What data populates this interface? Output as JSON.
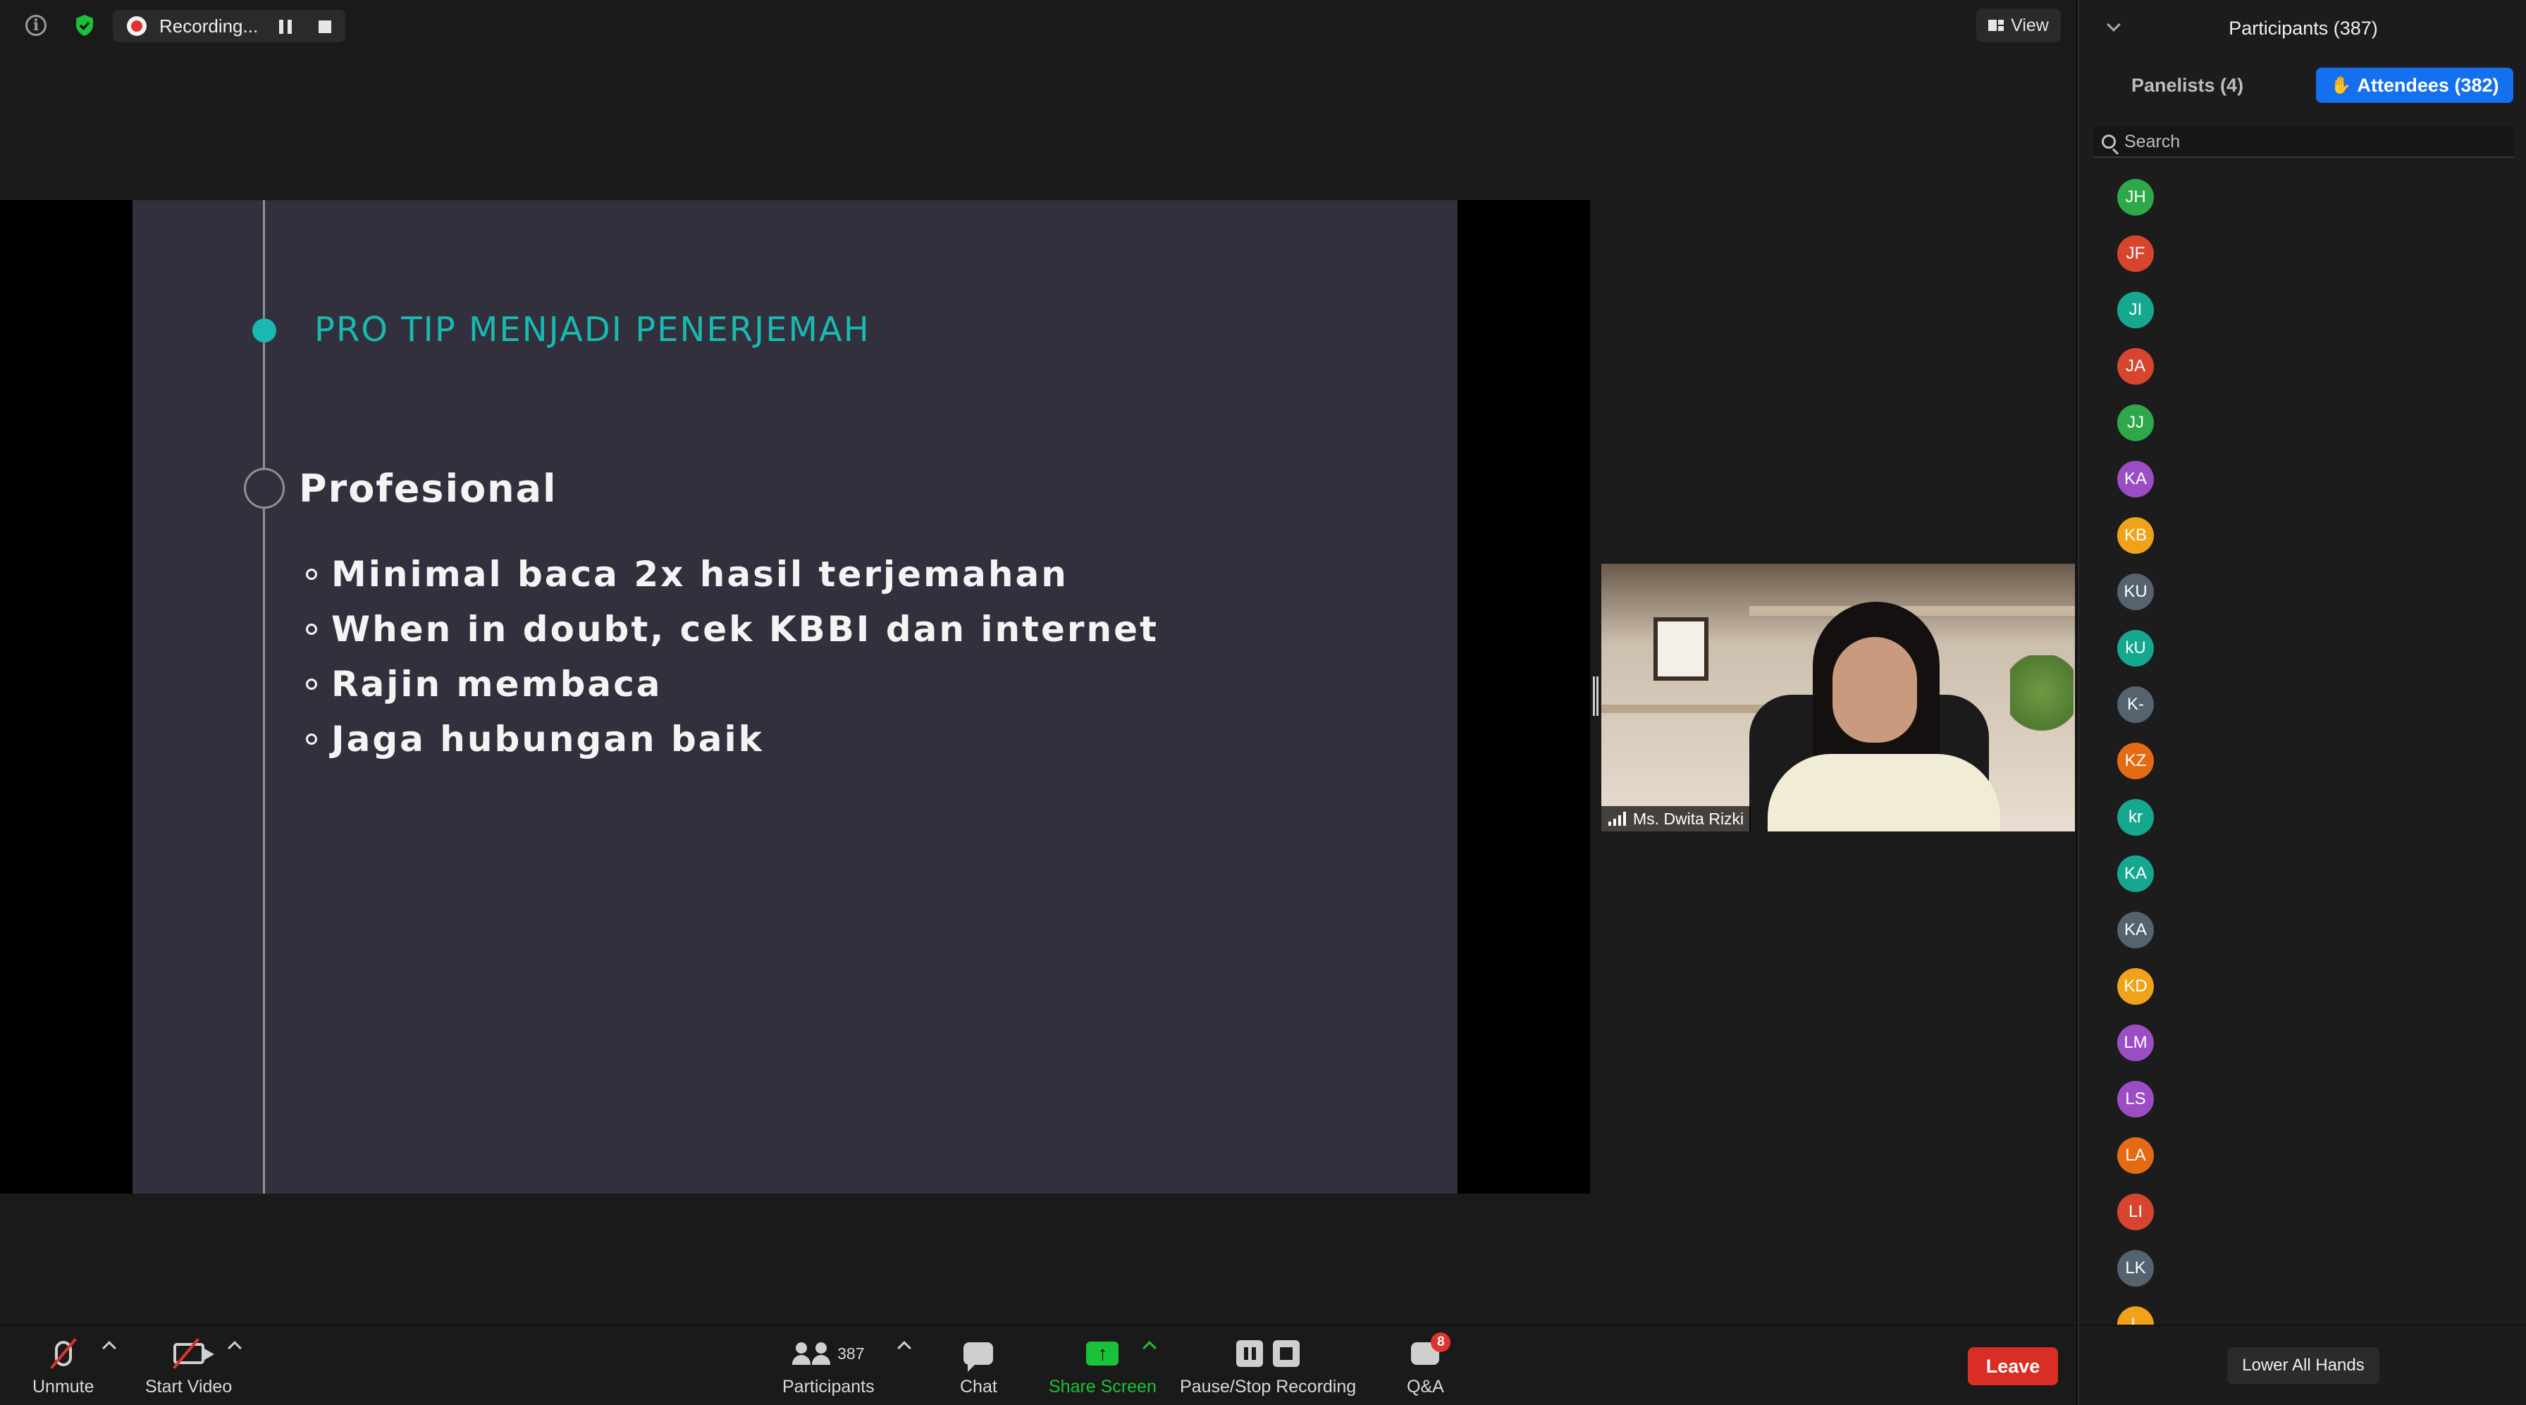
{
  "topbar": {
    "recording_label": "Recording...",
    "view_label": "View"
  },
  "slide": {
    "title": "PRO TIP MENJADI PENERJEMAH",
    "heading": "Profesional",
    "bullets": [
      "Minimal baca 2x hasil terjemahan",
      "When in doubt, cek KBBI dan internet",
      "Rajin membaca",
      "Jaga hubungan baik"
    ],
    "accent_color": "#19b8b0",
    "background_color": "#31303c"
  },
  "video": {
    "participant_name": "Ms. Dwita Rizki"
  },
  "toolbar": {
    "unmute_label": "Unmute",
    "start_video_label": "Start Video",
    "participants_label": "Participants",
    "participants_count": "387",
    "chat_label": "Chat",
    "share_screen_label": "Share Screen",
    "pause_stop_recording_label": "Pause/Stop Recording",
    "qa_label": "Q&A",
    "qa_badge": "8",
    "leave_label": "Leave"
  },
  "panel": {
    "title": "Participants (387)",
    "tab_panelists": "Panelists (4)",
    "tab_attendees": "Attendees (382)",
    "search_placeholder": "Search",
    "lower_all_hands": "Lower All Hands",
    "attendees": [
      {
        "initials": "JH",
        "color": "#2ea84a"
      },
      {
        "initials": "JF",
        "color": "#d8452e"
      },
      {
        "initials": "JI",
        "color": "#16a88e"
      },
      {
        "initials": "JA",
        "color": "#d8452e"
      },
      {
        "initials": "JJ",
        "color": "#2ea84a"
      },
      {
        "initials": "KA",
        "color": "#9b4dc4"
      },
      {
        "initials": "KB",
        "color": "#f0a31a"
      },
      {
        "initials": "KU",
        "color": "#556270"
      },
      {
        "initials": "kU",
        "color": "#16a88e"
      },
      {
        "initials": "K-",
        "color": "#556270"
      },
      {
        "initials": "KZ",
        "color": "#e56a14"
      },
      {
        "initials": "kr",
        "color": "#16a88e"
      },
      {
        "initials": "KA",
        "color": "#16a88e"
      },
      {
        "initials": "KA",
        "color": "#556270"
      },
      {
        "initials": "KD",
        "color": "#f0a31a"
      },
      {
        "initials": "LM",
        "color": "#9b4dc4"
      },
      {
        "initials": "LS",
        "color": "#9b4dc4"
      },
      {
        "initials": "LA",
        "color": "#e56a14"
      },
      {
        "initials": "LI",
        "color": "#d8452e"
      },
      {
        "initials": "LK",
        "color": "#556270"
      },
      {
        "initials": "L",
        "color": "#f0a31a"
      }
    ]
  }
}
